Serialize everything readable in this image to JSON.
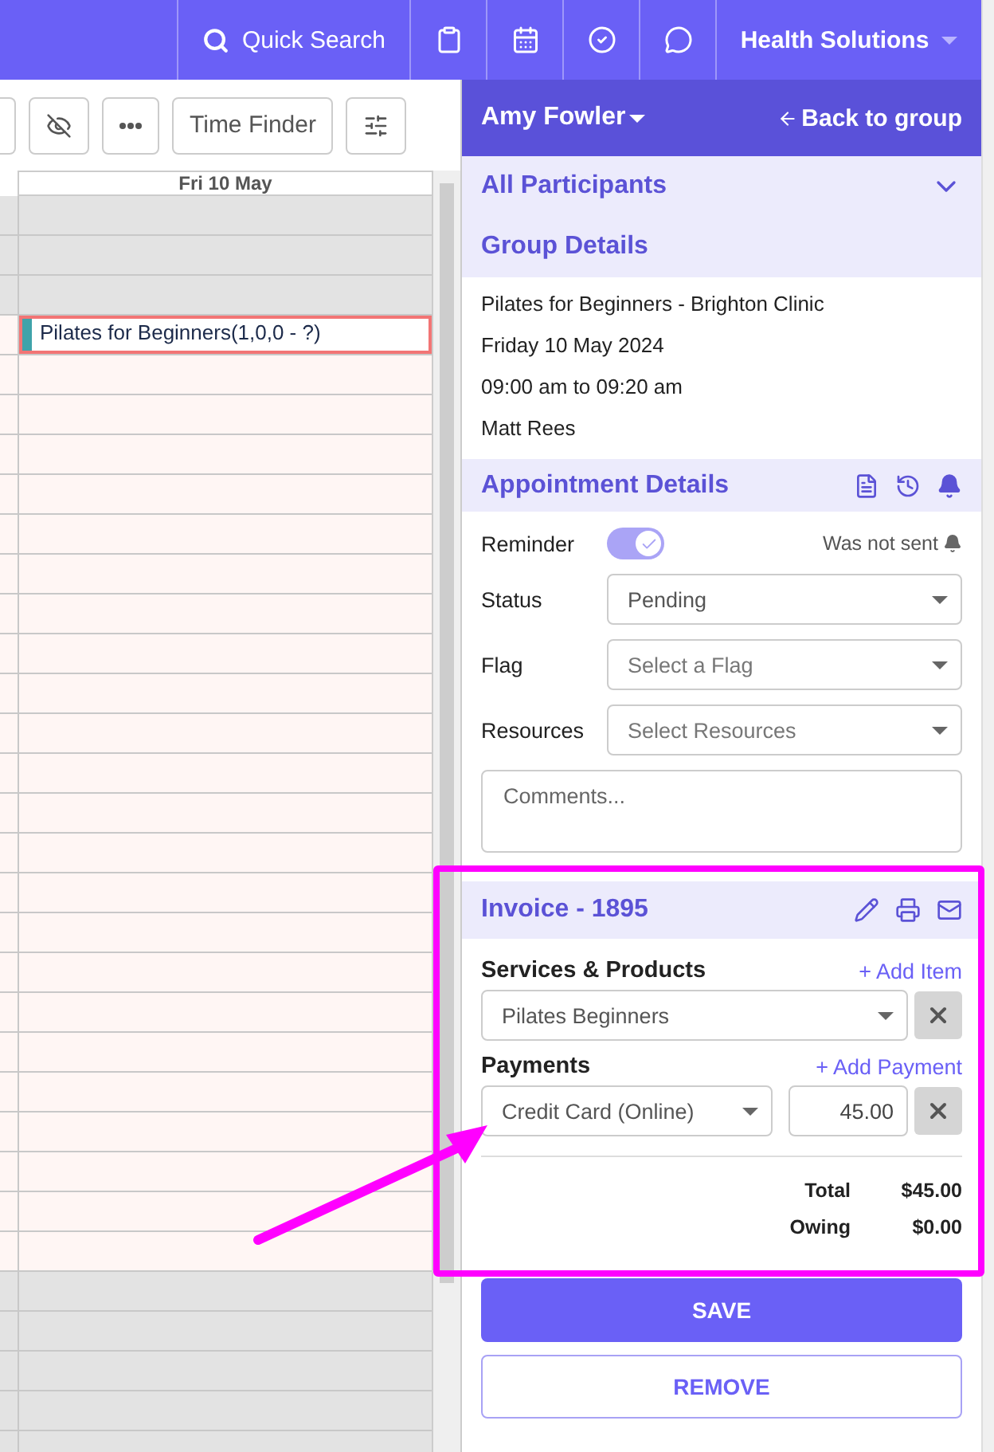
{
  "top_bar": {
    "search_label": "Quick Search",
    "workspace": "Health Solutions"
  },
  "toolbar": {
    "time_finder": "Time Finder"
  },
  "calendar": {
    "day_header": "Fri 10 May",
    "slots": [
      {
        "open": false
      },
      {
        "open": false
      },
      {
        "open": false
      },
      {
        "open": true,
        "event": {
          "title": "Pilates for Beginners(1,0,0 - ?)"
        }
      },
      {
        "open": true
      },
      {
        "open": true
      },
      {
        "open": true
      },
      {
        "open": true
      },
      {
        "open": true
      },
      {
        "open": true
      },
      {
        "open": true
      },
      {
        "open": true
      },
      {
        "open": true
      },
      {
        "open": true
      },
      {
        "open": true
      },
      {
        "open": true
      },
      {
        "open": true
      },
      {
        "open": true
      },
      {
        "open": true
      },
      {
        "open": true
      },
      {
        "open": true
      },
      {
        "open": true
      },
      {
        "open": true
      },
      {
        "open": true
      },
      {
        "open": true
      },
      {
        "open": true
      },
      {
        "open": true
      },
      {
        "open": false
      },
      {
        "open": false
      },
      {
        "open": false
      },
      {
        "open": false
      },
      {
        "open": false
      }
    ]
  },
  "panel": {
    "client": "Amy Fowler",
    "back_link": "Back to group",
    "participants_label": "All Participants",
    "group_title": "Group Details",
    "group_lines": [
      "Pilates for Beginners - Brighton Clinic",
      "Friday 10 May 2024",
      "09:00 am to 09:20 am",
      "Matt Rees"
    ],
    "appointment_title": "Appointment Details",
    "reminder": {
      "label": "Reminder",
      "on": true,
      "status": "Was not sent"
    },
    "fields": [
      {
        "label": "Status",
        "value": "Pending"
      },
      {
        "label": "Flag",
        "placeholder": "Select a Flag"
      },
      {
        "label": "Resources",
        "placeholder": "Select Resources"
      }
    ],
    "comments": {
      "placeholder": "Comments..."
    }
  },
  "invoice": {
    "title": "Invoice - 1895",
    "services_label": "Services & Products",
    "add_item": "+ Add Item",
    "items": [
      {
        "value": "Pilates Beginners"
      }
    ],
    "payments_label": "Payments",
    "add_payment": "+ Add Payment",
    "payments": [
      {
        "method": "Credit Card (Online)",
        "amount": "45.00"
      }
    ],
    "totals": [
      {
        "label": "Total",
        "value": "$45.00"
      },
      {
        "label": "Owing",
        "value": "$0.00"
      }
    ]
  },
  "actions": {
    "save": "SAVE",
    "remove": "REMOVE"
  }
}
